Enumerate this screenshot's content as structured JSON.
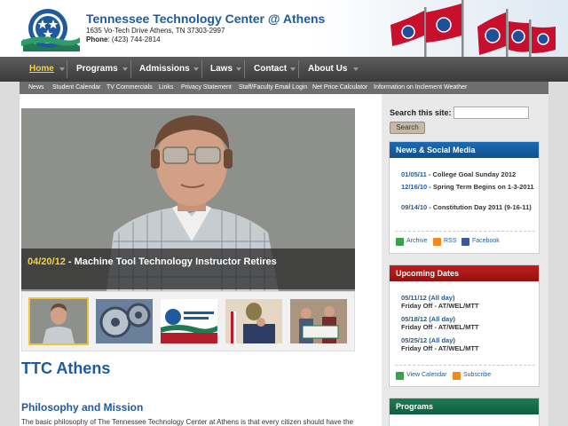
{
  "header": {
    "title": "Tennessee Technology Center @ Athens",
    "address": "1635 Vo-Tech Drive Athens, TN 37303-2997",
    "phone_label": "Phone",
    "phone_value": ": (423) 744-2814"
  },
  "nav": {
    "items": [
      "Home",
      "Programs",
      "Admissions",
      "Laws",
      "Contact",
      "About Us"
    ]
  },
  "subnav": {
    "items": [
      "News",
      "Student Calendar",
      "TV Commercials",
      "Links",
      "Privacy Statement",
      "Staff/Faculty Email Login",
      "Net Price Calculator",
      "Information on Inclement Weather"
    ]
  },
  "feature": {
    "date": "04/20/12",
    "title": " - Machine Tool Technology Instructor Retires"
  },
  "main": {
    "page_title": "TTC Athens",
    "section_title": "Philosophy and Mission",
    "body": "The basic philosophy of The Tennessee Technology Center at Athens is that every citizen should have the"
  },
  "sidebar": {
    "search_label": "Search this site:",
    "search_value": "",
    "search_button": "Search",
    "news": {
      "title": "News & Social Media",
      "items": [
        {
          "date": "01/05/11",
          "text": " - College Goal Sunday 2012"
        },
        {
          "date": "12/16/10",
          "text": " - Spring Term Begins on 1-3-2011"
        },
        {
          "date": "09/14/10",
          "text": " - Constitution Day 2011 (9-16-11)"
        }
      ],
      "links": [
        "Archive",
        "RSS",
        "Facebook"
      ]
    },
    "dates": {
      "title": "Upcoming Dates",
      "items": [
        {
          "date": "05/11/12 (All day)",
          "text": "Friday Off - AT/WEL/MTT"
        },
        {
          "date": "05/18/12 (All day)",
          "text": "Friday Off - AT/WEL/MTT"
        },
        {
          "date": "05/25/12 (All day)",
          "text": "Friday Off - AT/WEL/MTT"
        }
      ],
      "links": [
        "View Calendar",
        "Subscribe"
      ]
    },
    "programs": {
      "title": "Programs"
    }
  },
  "colors": {
    "brand_blue": "#1f5a9e",
    "nav_active": "#f5d23c",
    "news_head": "#1d6bb3",
    "dates_head": "#c21e1e",
    "programs_head": "#1e7b54"
  }
}
